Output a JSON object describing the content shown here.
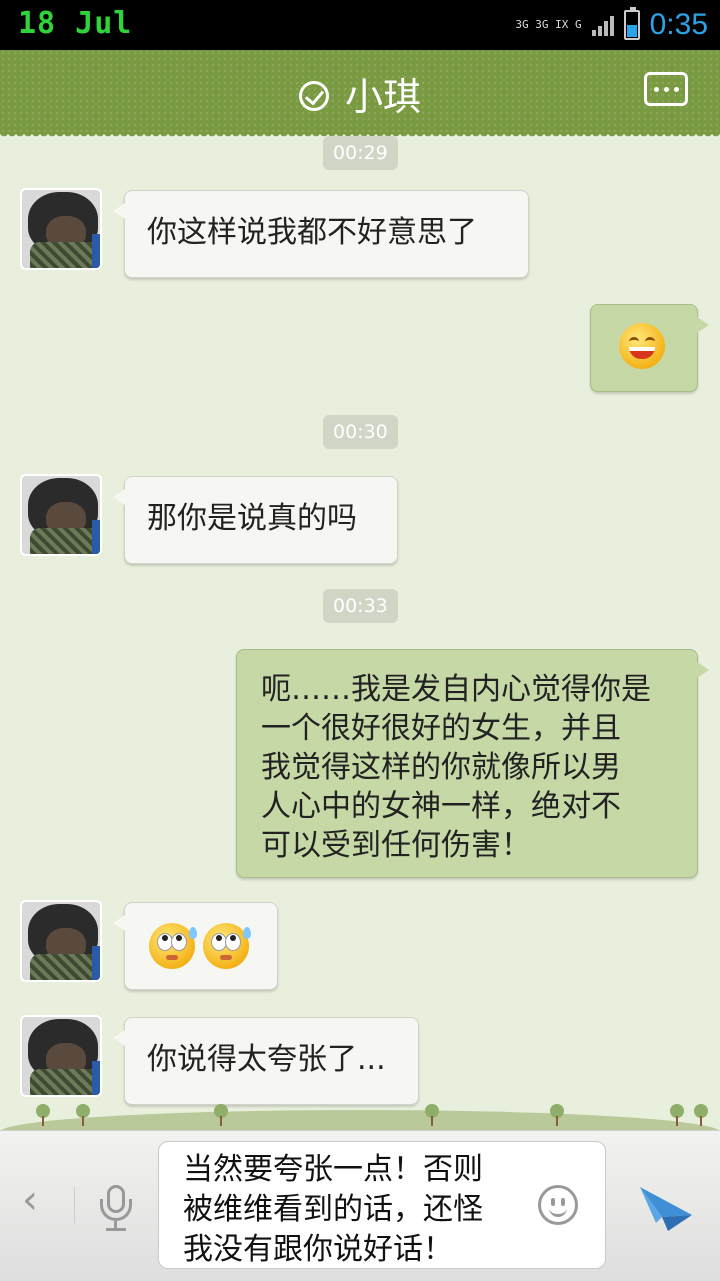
{
  "status_bar": {
    "date": "18 Jul",
    "network": [
      "3G",
      "3G",
      "IX",
      "G"
    ],
    "time": "0:35"
  },
  "header": {
    "title": "小琪",
    "verified_icon": "check-circle-icon",
    "more_icon": "chat-more-icon"
  },
  "messages": [
    {
      "type": "timestamp",
      "text": "00:29"
    },
    {
      "type": "incoming",
      "text": "你这样说我都不好意思了"
    },
    {
      "type": "outgoing",
      "emoji": [
        "grin-emoji"
      ]
    },
    {
      "type": "timestamp",
      "text": "00:30"
    },
    {
      "type": "incoming",
      "text": "那你是说真的吗"
    },
    {
      "type": "timestamp",
      "text": "00:33"
    },
    {
      "type": "outgoing",
      "lines": [
        "呃……我是发自内心觉得你是",
        "一个很好很好的女生，并且",
        "我觉得这样的你就像所以男",
        "人心中的女神一样，绝对不",
        "可以受到任何伤害！"
      ]
    },
    {
      "type": "incoming",
      "emoji": [
        "eye-roll-emoji",
        "eye-roll-emoji"
      ]
    },
    {
      "type": "incoming",
      "text": "你说得太夸张了..."
    }
  ],
  "input_bar": {
    "value": "当然要夸张一点！否则\n被维维看到的话，还怪\n我没有跟你说好话！",
    "back_glyph": "‹",
    "icons": [
      "back-arrow-icon",
      "microphone-icon",
      "smiley-icon",
      "send-icon"
    ]
  },
  "colors": {
    "header_bg": "#7a9a42",
    "chat_bg": "#e8efdc",
    "outgoing_bubble": "#c7d8a7",
    "incoming_bubble": "#f6f6f3",
    "time_text": "#2aa4e8",
    "date_text": "#2fd43a",
    "send_icon": "#3f8fd6"
  }
}
